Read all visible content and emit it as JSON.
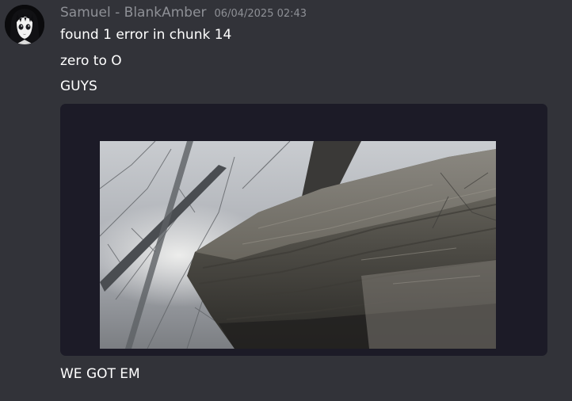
{
  "message": {
    "author": "Samuel - BlankAmber",
    "timestamp": "06/04/2025 02:43",
    "avatar_icon": "anime-girl-avatar",
    "lines": [
      "found 1 error in chunk 14",
      "zero to O",
      "GUYS"
    ],
    "after_attachment": "WE GOT EM",
    "attachment": {
      "kind": "image",
      "subject": "rock-cliff-with-bare-trees-photo"
    }
  },
  "colors": {
    "background": "#323339",
    "text": "#ffffff",
    "muted": "#8e9096",
    "embed_background": "#1c1b27"
  }
}
